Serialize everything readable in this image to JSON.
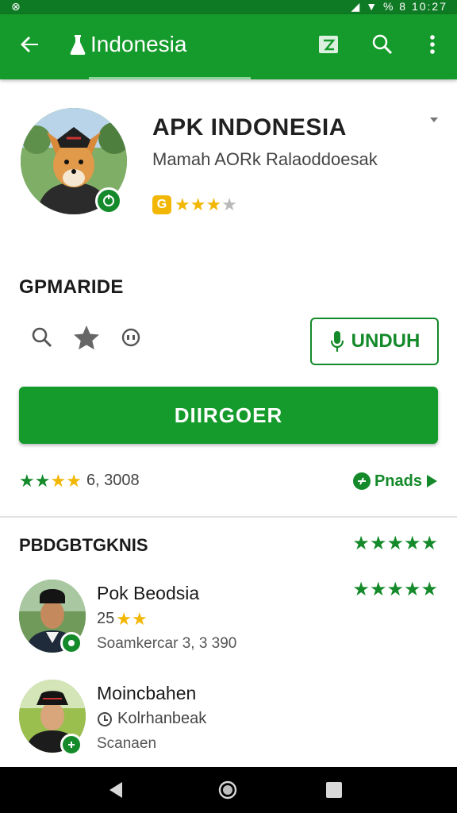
{
  "status_bar": {
    "time": "10:27",
    "battery": "% 8"
  },
  "toolbar": {
    "title": "Indonesia"
  },
  "app": {
    "name": "APK INDONESIA",
    "developer": "Mamah AORk Ralaoddoesak",
    "rating_badge": "G"
  },
  "section_label": "GPMARIDE",
  "buttons": {
    "unduh": "UNDUH",
    "primary": "DIIRGOER"
  },
  "stats": {
    "count": "6, 3008",
    "reads_label": "Pnads"
  },
  "reviews": {
    "heading": "PBDGBTGKNIS",
    "items": [
      {
        "name": "Pok Beodsia",
        "meta": "25",
        "detail": "Soamkercar 3, 3 390"
      },
      {
        "name": "Moincbahen",
        "meta": "Kolrhanbeak",
        "detail": "Scanaen"
      }
    ]
  },
  "colors": {
    "primary": "#159b2c",
    "dark": "#0f7a24",
    "accent_star": "#f2b705"
  }
}
